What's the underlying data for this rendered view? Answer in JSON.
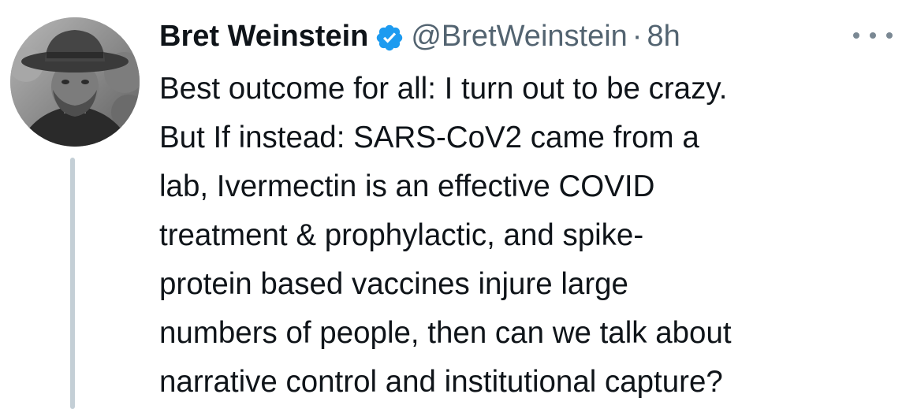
{
  "tweet": {
    "author_name": "Bret Weinstein",
    "handle": "@BretWeinstein",
    "separator": "·",
    "time": "8h",
    "verified": true,
    "text_lines": [
      "Best outcome for all: I turn out to be crazy.",
      "But If instead: SARS-CoV2 came from a",
      "lab, Ivermectin is an effective COVID",
      "treatment & prophylactic, and spike-",
      "protein based vaccines injure large",
      "numbers of people, then can we talk about",
      "narrative control and institutional capture?"
    ]
  },
  "icons": {
    "verified": "verified-badge-icon",
    "more": "more-options-icon"
  },
  "colors": {
    "verified_blue": "#1d9bf0",
    "text": "#0f1419",
    "secondary_text": "#536471",
    "thread_line": "#c4cfd6",
    "background": "#ffffff"
  }
}
